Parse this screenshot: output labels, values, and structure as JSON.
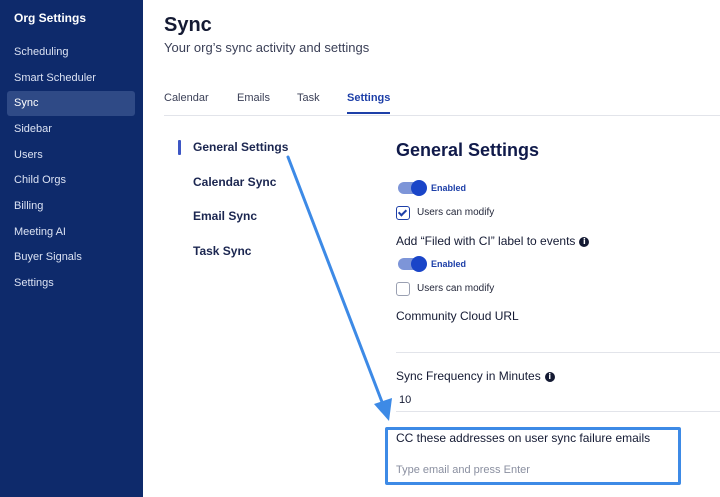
{
  "sidebar": {
    "title": "Org Settings",
    "items": [
      {
        "label": "Scheduling"
      },
      {
        "label": "Smart Scheduler"
      },
      {
        "label": "Sync"
      },
      {
        "label": "Sidebar"
      },
      {
        "label": "Users"
      },
      {
        "label": "Child Orgs"
      },
      {
        "label": "Billing"
      },
      {
        "label": "Meeting AI"
      },
      {
        "label": "Buyer Signals"
      },
      {
        "label": "Settings"
      }
    ],
    "active_item": "Sync"
  },
  "header": {
    "title": "Sync",
    "subtitle": "Your org’s sync activity and settings"
  },
  "tabs": [
    {
      "label": "Calendar"
    },
    {
      "label": "Emails"
    },
    {
      "label": "Task"
    },
    {
      "label": "Settings"
    }
  ],
  "active_tab": "Settings",
  "settings_nav": [
    {
      "label": "General Settings"
    },
    {
      "label": "Calendar Sync"
    },
    {
      "label": "Email Sync"
    },
    {
      "label": "Task Sync"
    }
  ],
  "general": {
    "title": "General Settings",
    "sync_toggle": {
      "label": "Enabled",
      "on": true
    },
    "sync_users_can_modify": {
      "label": "Users can modify",
      "checked": true
    },
    "filed_label_heading": "Add “Filed with CI” label to events",
    "filed_toggle": {
      "label": "Enabled",
      "on": true
    },
    "filed_users_can_modify": {
      "label": "Users can modify",
      "checked": false
    },
    "community_cloud_url_label": "Community Cloud URL",
    "sync_frequency_label": "Sync Frequency in Minutes",
    "sync_frequency_value": "10",
    "cc_label": "CC these addresses on user sync failure emails",
    "cc_placeholder": "Type email and press Enter"
  },
  "colors": {
    "sidebar_bg": "#0e2a6b",
    "accent": "#1d3fa8",
    "highlight": "#3d8ae6"
  },
  "icons": {
    "info": "info-icon",
    "annotation": "arrow-annotation-icon"
  }
}
